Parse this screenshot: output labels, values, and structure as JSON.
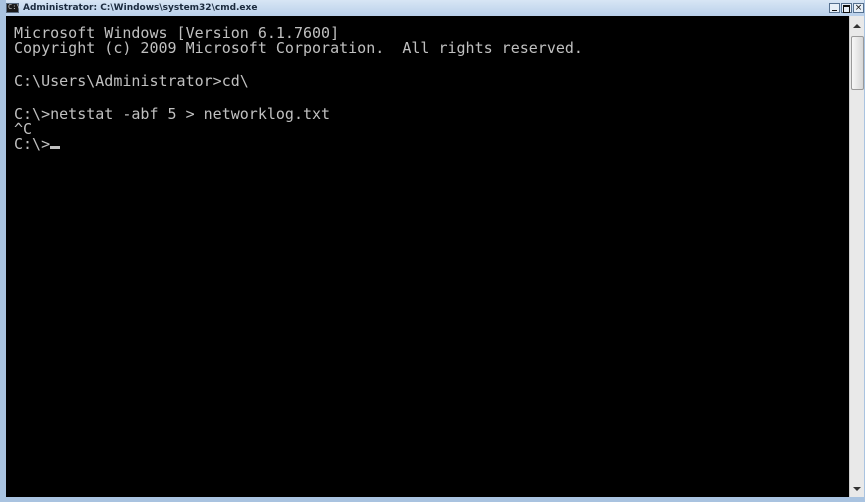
{
  "window": {
    "title": "Administrator: C:\\Windows\\system32\\cmd.exe",
    "icon": "cmd-icon",
    "icon_glyph": "C:\\",
    "buttons": {
      "minimize": "minimize-icon",
      "maximize": "maximize-icon",
      "close": "close-icon",
      "close_glyph": "×"
    }
  },
  "console": {
    "background": "#000000",
    "foreground": "#c0c0c0",
    "lines": [
      "Microsoft Windows [Version 6.1.7600]",
      "Copyright (c) 2009 Microsoft Corporation.  All rights reserved.",
      "",
      "C:\\Users\\Administrator>cd\\",
      "",
      "C:\\>netstat -abf 5 > networklog.txt",
      "^C",
      "C:\\>"
    ]
  },
  "scrollbar": {
    "up": "scroll-up-arrow-icon",
    "down": "scroll-down-arrow-icon"
  }
}
